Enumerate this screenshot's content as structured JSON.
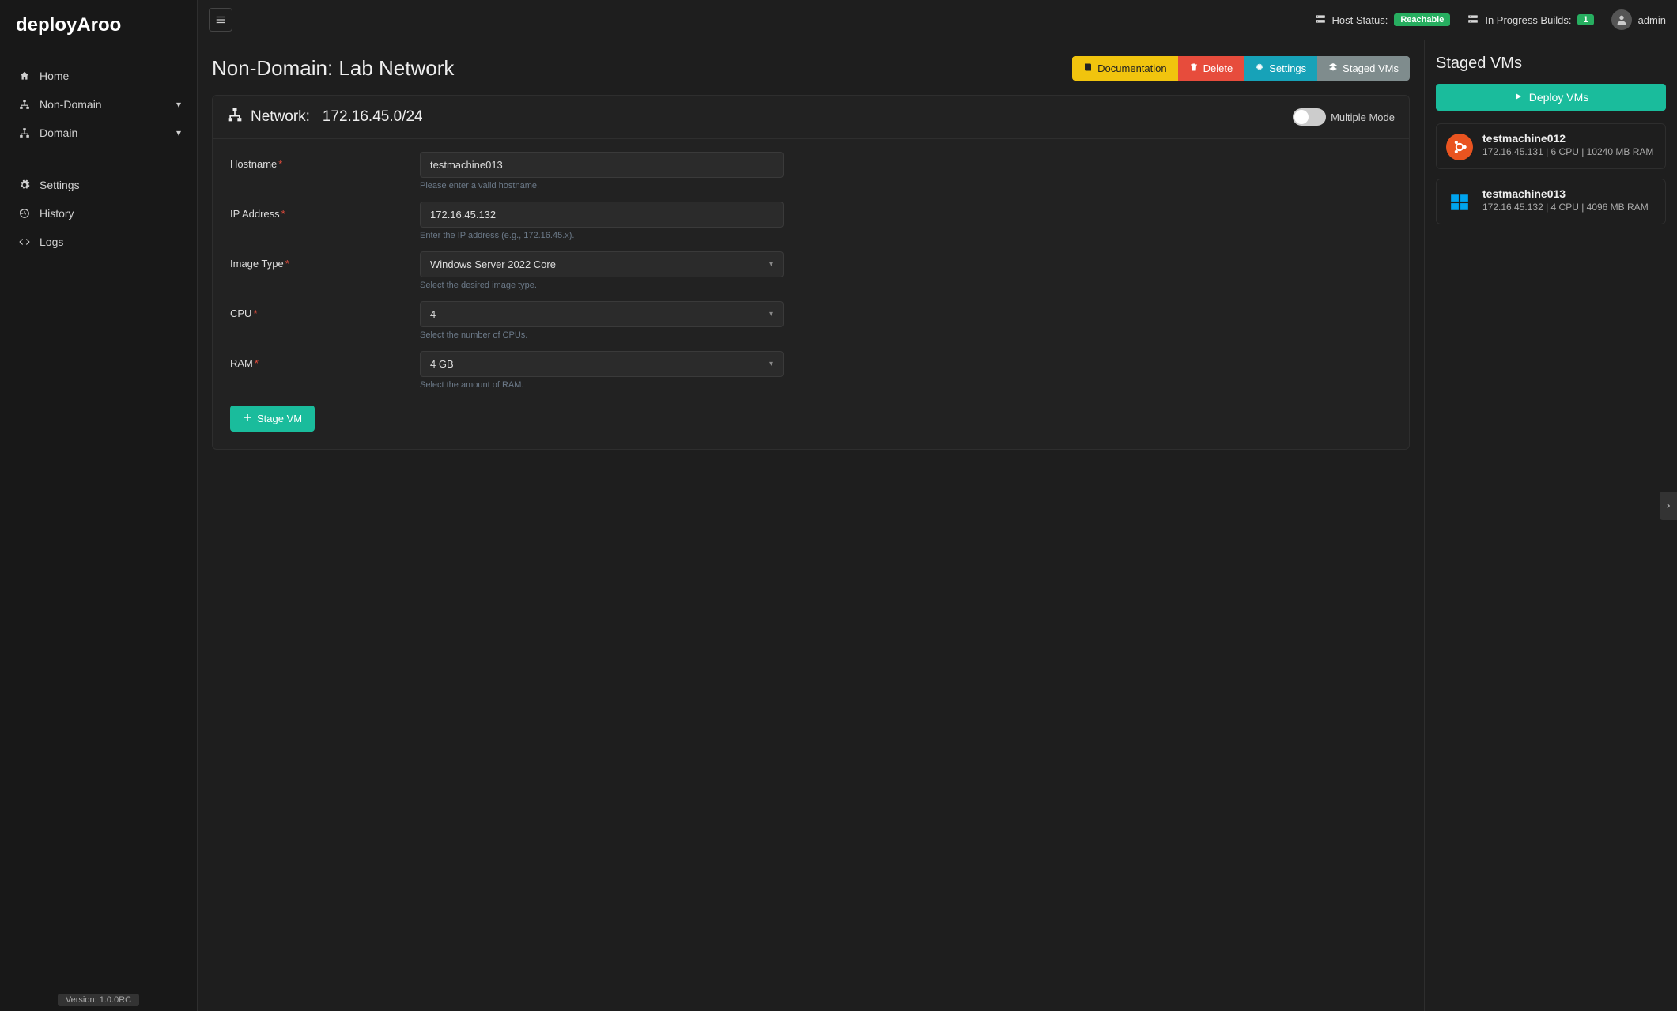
{
  "brand": "deployAroo",
  "sidebar": {
    "items": [
      {
        "label": "Home",
        "icon": "home"
      },
      {
        "label": "Non-Domain",
        "icon": "sitemap",
        "expandable": true
      },
      {
        "label": "Domain",
        "icon": "sitemap",
        "expandable": true
      }
    ],
    "bottom_items": [
      {
        "label": "Settings",
        "icon": "gear"
      },
      {
        "label": "History",
        "icon": "history"
      },
      {
        "label": "Logs",
        "icon": "code"
      }
    ],
    "version": "Version: 1.0.0RC"
  },
  "topbar": {
    "host_status_label": "Host Status:",
    "host_status_value": "Reachable",
    "builds_label": "In Progress Builds:",
    "builds_count": "1",
    "user": "admin"
  },
  "page": {
    "title": "Non-Domain: Lab Network",
    "actions": {
      "documentation": "Documentation",
      "delete": "Delete",
      "settings": "Settings",
      "staged": "Staged VMs"
    }
  },
  "network_card": {
    "heading_prefix": "Network:",
    "network": "172.16.45.0/24",
    "multiple_mode_label": "Multiple Mode",
    "fields": {
      "hostname": {
        "label": "Hostname",
        "value": "testmachine013",
        "hint": "Please enter a valid hostname."
      },
      "ip": {
        "label": "IP Address",
        "value": "172.16.45.132",
        "hint": "Enter the IP address (e.g., 172.16.45.x)."
      },
      "image": {
        "label": "Image Type",
        "value": "Windows Server 2022 Core",
        "hint": "Select the desired image type."
      },
      "cpu": {
        "label": "CPU",
        "value": "4",
        "hint": "Select the number of CPUs."
      },
      "ram": {
        "label": "RAM",
        "value": "4 GB",
        "hint": "Select the amount of RAM."
      }
    },
    "stage_btn": "Stage VM"
  },
  "right_panel": {
    "title": "Staged VMs",
    "deploy_btn": "Deploy VMs",
    "vms": [
      {
        "name": "testmachine012",
        "meta": "172.16.45.131 | 6 CPU | 10240 MB RAM",
        "os": "ubuntu"
      },
      {
        "name": "testmachine013",
        "meta": "172.16.45.132 | 4 CPU | 4096 MB RAM",
        "os": "windows"
      }
    ]
  }
}
